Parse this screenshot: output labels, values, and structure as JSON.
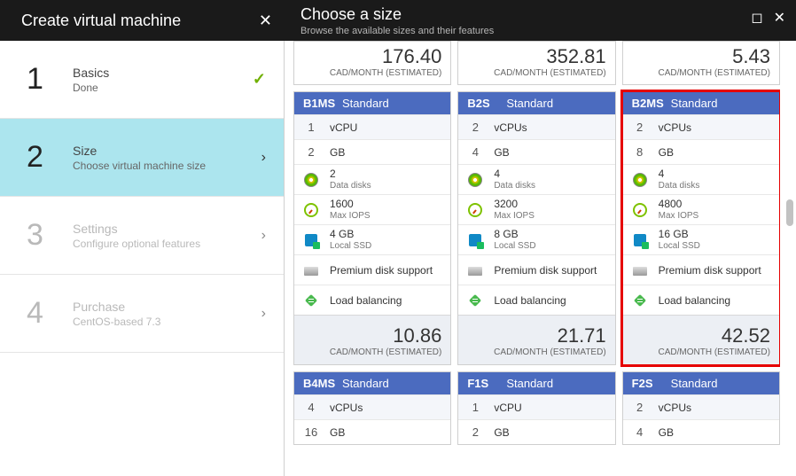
{
  "header": {
    "leftTitle": "Create virtual machine",
    "rightTitle": "Choose a size",
    "rightSub": "Browse the available sizes and their features"
  },
  "steps": [
    {
      "num": "1",
      "title": "Basics",
      "sub": "Done",
      "state": "done"
    },
    {
      "num": "2",
      "title": "Size",
      "sub": "Choose virtual machine size",
      "state": "active"
    },
    {
      "num": "3",
      "title": "Settings",
      "sub": "Configure optional features",
      "state": "dis"
    },
    {
      "num": "4",
      "title": "Purchase",
      "sub": "CentOS-based 7.3",
      "state": "dis"
    }
  ],
  "priceUnit": "CAD/MONTH (ESTIMATED)",
  "topPrices": [
    "176.40",
    "352.81",
    "5.43"
  ],
  "cards": [
    {
      "code": "B1MS",
      "tier": "Standard",
      "hl": false,
      "rows": [
        {
          "t": "vcpu",
          "lead": "1",
          "lbl": "vCPU"
        },
        {
          "t": "mem",
          "lead": "2",
          "lbl": "GB"
        },
        {
          "t": "disk",
          "val": "2",
          "lbl": "Data disks"
        },
        {
          "t": "iops",
          "val": "1600",
          "lbl": "Max IOPS"
        },
        {
          "t": "ssd",
          "val": "4 GB",
          "lbl": "Local SSD"
        },
        {
          "t": "prem",
          "lbl": "Premium disk support"
        },
        {
          "t": "lb",
          "lbl": "Load balancing"
        }
      ],
      "price": "10.86"
    },
    {
      "code": "B2S",
      "tier": "Standard",
      "hl": false,
      "rows": [
        {
          "t": "vcpu",
          "lead": "2",
          "lbl": "vCPUs"
        },
        {
          "t": "mem",
          "lead": "4",
          "lbl": "GB"
        },
        {
          "t": "disk",
          "val": "4",
          "lbl": "Data disks"
        },
        {
          "t": "iops",
          "val": "3200",
          "lbl": "Max IOPS"
        },
        {
          "t": "ssd",
          "val": "8 GB",
          "lbl": "Local SSD"
        },
        {
          "t": "prem",
          "lbl": "Premium disk support"
        },
        {
          "t": "lb",
          "lbl": "Load balancing"
        }
      ],
      "price": "21.71"
    },
    {
      "code": "B2MS",
      "tier": "Standard",
      "hl": true,
      "rows": [
        {
          "t": "vcpu",
          "lead": "2",
          "lbl": "vCPUs"
        },
        {
          "t": "mem",
          "lead": "8",
          "lbl": "GB"
        },
        {
          "t": "disk",
          "val": "4",
          "lbl": "Data disks"
        },
        {
          "t": "iops",
          "val": "4800",
          "lbl": "Max IOPS"
        },
        {
          "t": "ssd",
          "val": "16 GB",
          "lbl": "Local SSD"
        },
        {
          "t": "prem",
          "lbl": "Premium disk support"
        },
        {
          "t": "lb",
          "lbl": "Load balancing"
        }
      ],
      "price": "42.52"
    }
  ],
  "bottomCards": [
    {
      "code": "B4MS",
      "tier": "Standard",
      "rows": [
        {
          "lead": "4",
          "lbl": "vCPUs"
        },
        {
          "lead": "16",
          "lbl": "GB"
        }
      ]
    },
    {
      "code": "F1S",
      "tier": "Standard",
      "rows": [
        {
          "lead": "1",
          "lbl": "vCPU"
        },
        {
          "lead": "2",
          "lbl": "GB"
        }
      ]
    },
    {
      "code": "F2S",
      "tier": "Standard",
      "rows": [
        {
          "lead": "2",
          "lbl": "vCPUs"
        },
        {
          "lead": "4",
          "lbl": "GB"
        }
      ]
    }
  ]
}
